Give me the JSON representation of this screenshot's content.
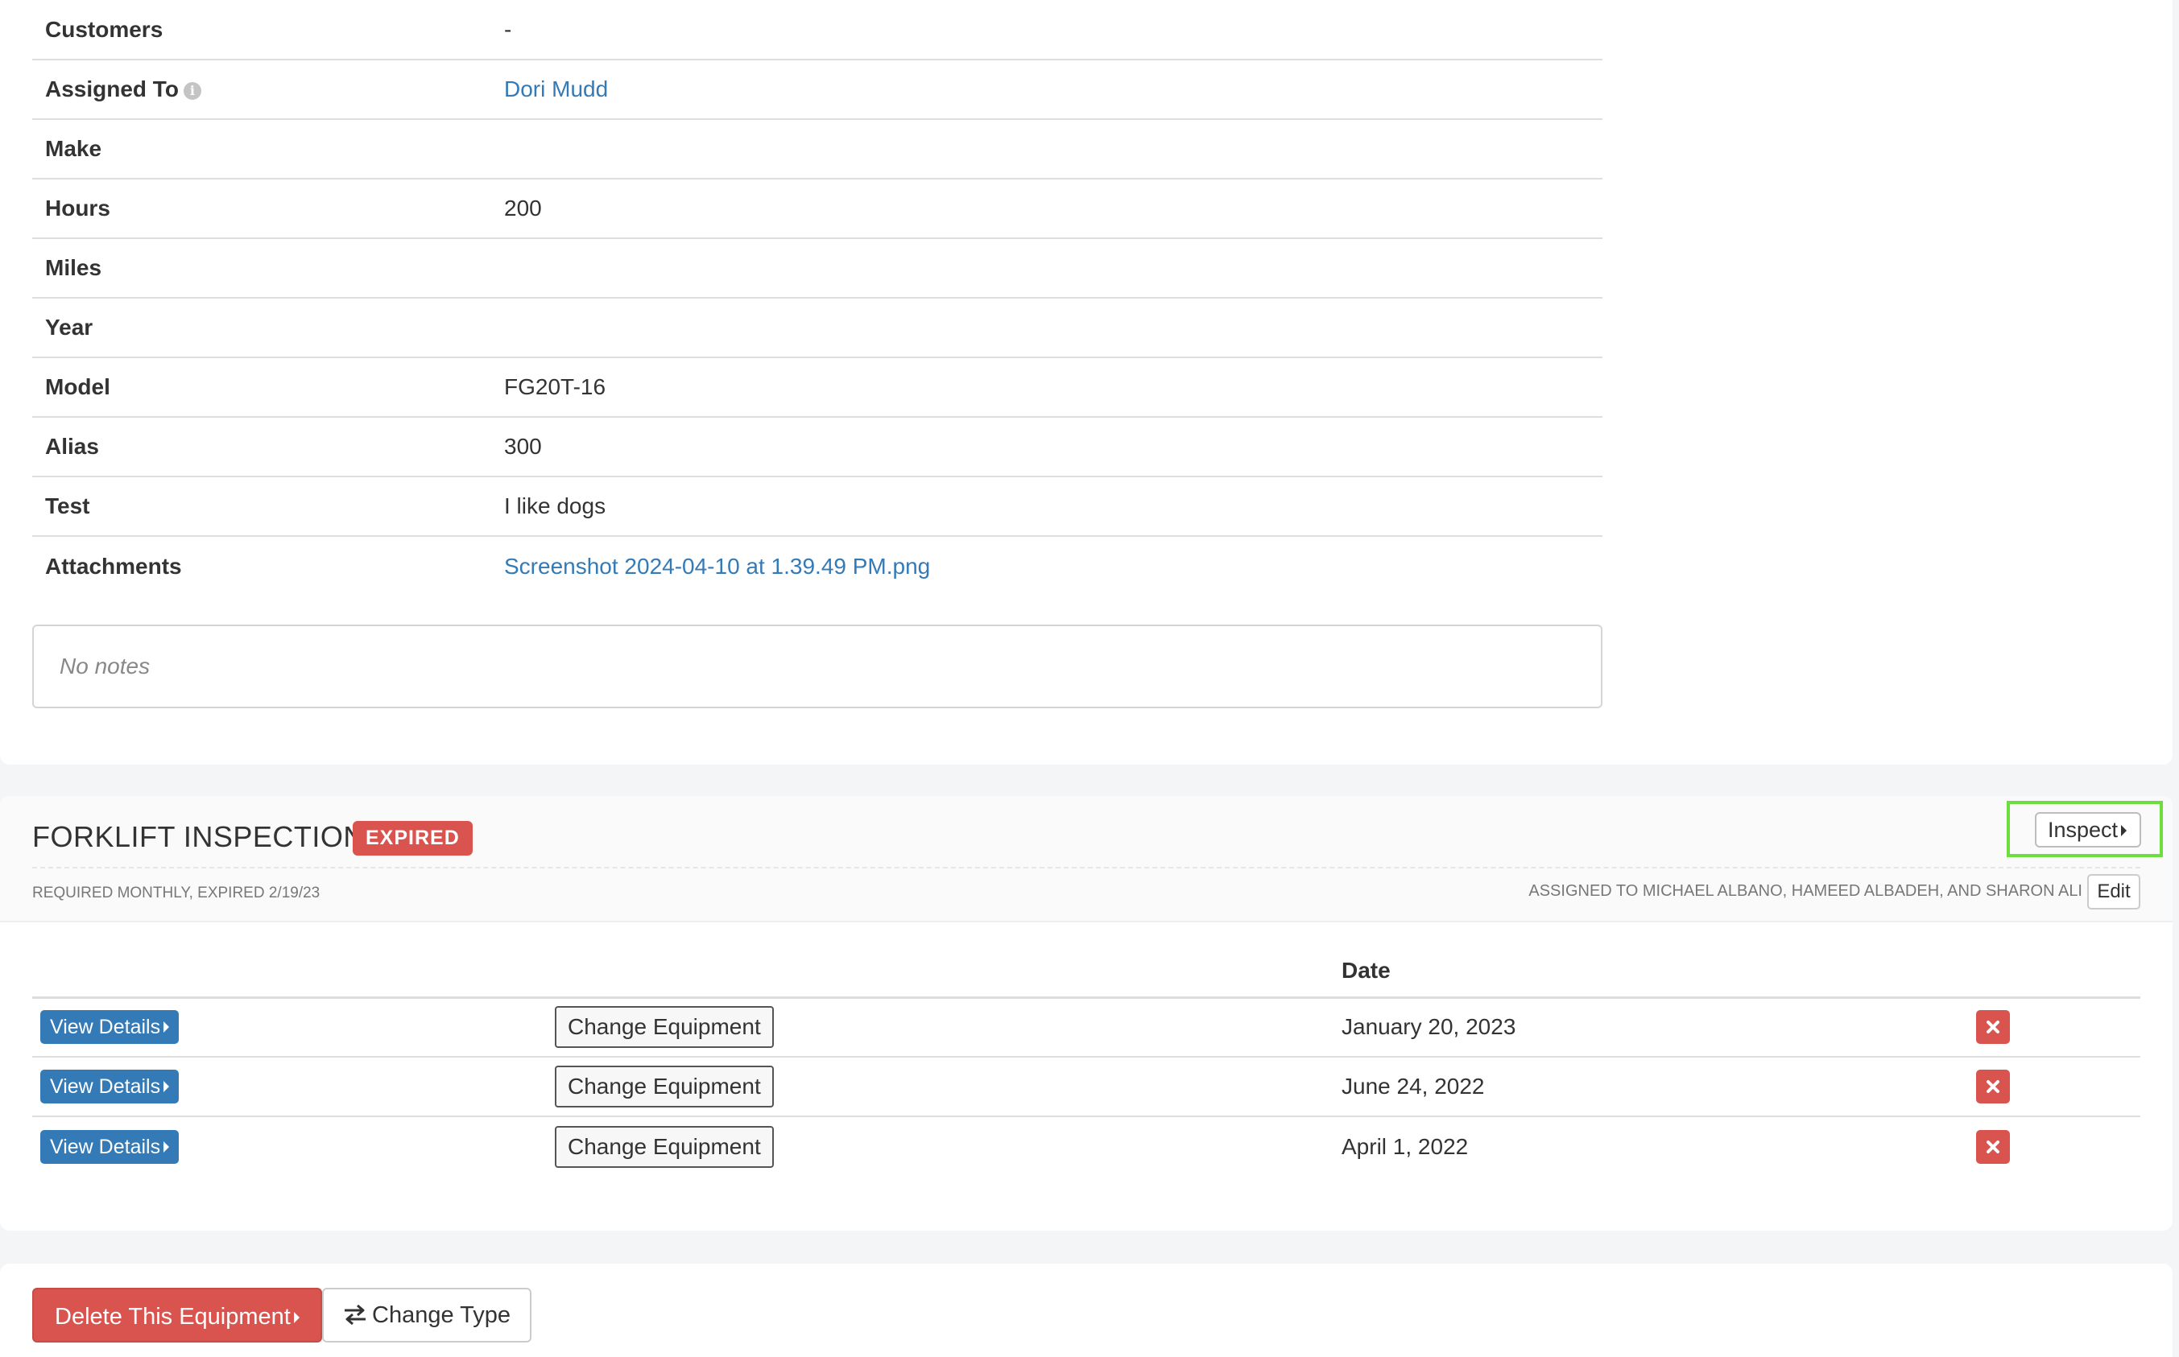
{
  "details": {
    "rows": [
      {
        "label": "Customers",
        "value": "-"
      },
      {
        "label": "Assigned To",
        "value": "Dori Mudd"
      },
      {
        "label": "Make",
        "value": ""
      },
      {
        "label": "Hours",
        "value": "200"
      },
      {
        "label": "Miles",
        "value": ""
      },
      {
        "label": "Year",
        "value": ""
      },
      {
        "label": "Model",
        "value": "FG20T-16"
      },
      {
        "label": "Alias",
        "value": "300"
      },
      {
        "label": "Test",
        "value": "I like dogs"
      },
      {
        "label": "Attachments",
        "value": "Screenshot 2024-04-10 at 1.39.49 PM.png"
      }
    ],
    "info_icon": "i",
    "notes": "No notes"
  },
  "inspection": {
    "title": "FORKLIFT INSPECTION",
    "badge": "EXPIRED",
    "subtitle": "REQUIRED MONTHLY, EXPIRED 2/19/23",
    "assigned": "ASSIGNED TO MICHAEL ALBANO, HAMEED ALBADEH, AND SHARON ALI",
    "edit_label": "Edit",
    "inspect_label": "Inspect",
    "date_header": "Date",
    "records": [
      {
        "view_label": "View Details",
        "change_label": "Change Equipment",
        "date": "January 20, 2023"
      },
      {
        "view_label": "View Details",
        "change_label": "Change Equipment",
        "date": "June 24, 2022"
      },
      {
        "view_label": "View Details",
        "change_label": "Change Equipment",
        "date": "April 1, 2022"
      }
    ]
  },
  "actions": {
    "delete_label": "Delete This Equipment",
    "change_type_label": "Change Type"
  },
  "colors": {
    "link": "#337ab7",
    "danger": "#d9534f",
    "primary": "#337ab7",
    "highlight": "#6cde3e"
  }
}
